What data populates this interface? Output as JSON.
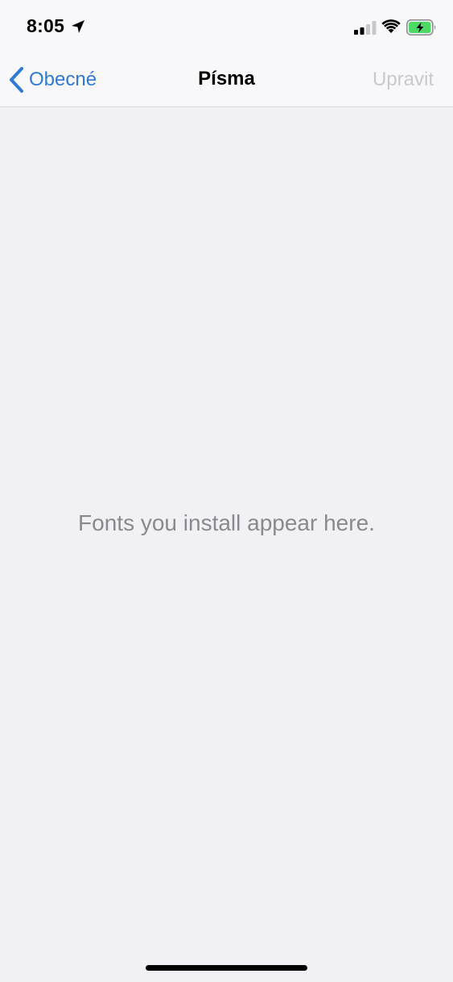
{
  "status_bar": {
    "time": "8:05",
    "icons": [
      "location-arrow-icon",
      "cellular-signal-icon",
      "wifi-icon",
      "battery-charging-icon"
    ],
    "battery_color": "#4cd964"
  },
  "nav": {
    "back_label": "Obecné",
    "title": "Písma",
    "edit_label": "Upravit",
    "accent_color": "#2f7ad6",
    "disabled_color": "#c9c8cd"
  },
  "main": {
    "empty_message": "Fonts you install appear here."
  }
}
